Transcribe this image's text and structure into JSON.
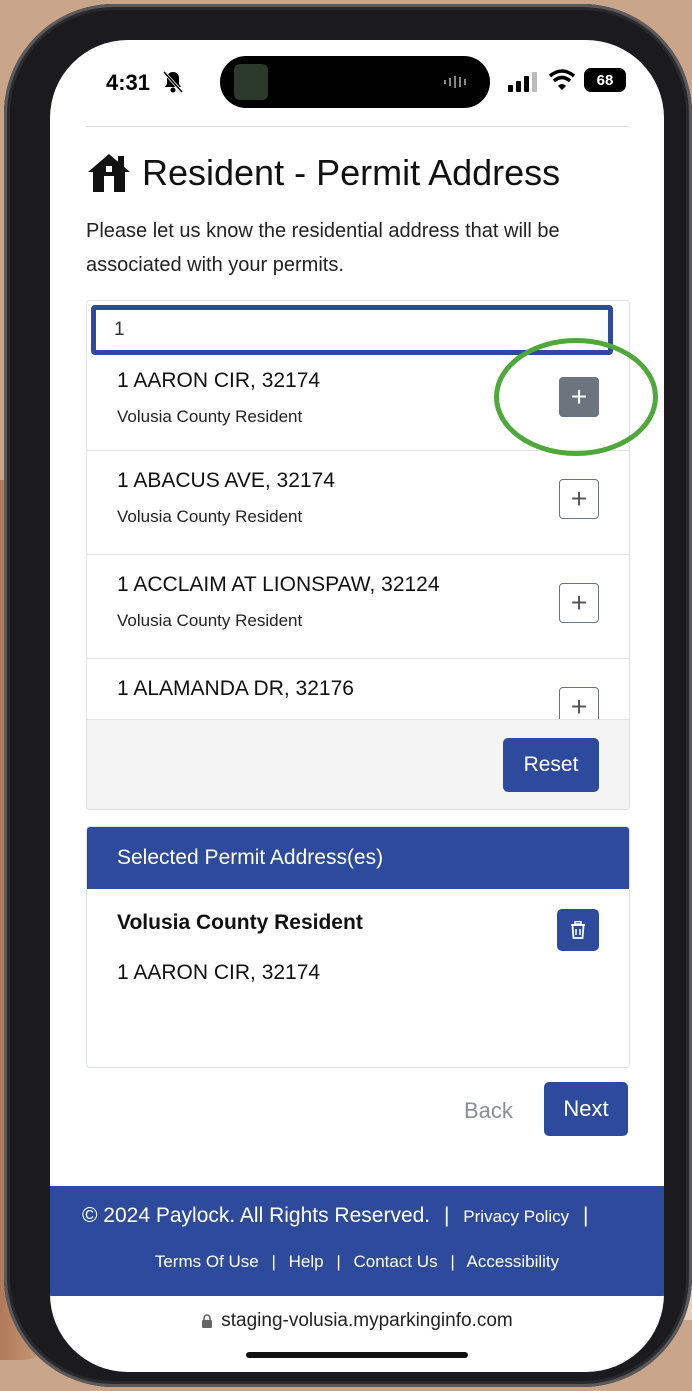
{
  "status_bar": {
    "time": "4:31",
    "battery": "68"
  },
  "page": {
    "title": "Resident - Permit Address",
    "intro": "Please let us know the residential address that will be associated with your permits."
  },
  "search": {
    "value": "1"
  },
  "results": [
    {
      "address": "1 AARON CIR, 32174",
      "type": "Volusia County Resident"
    },
    {
      "address": "1 ABACUS AVE, 32174",
      "type": "Volusia County Resident"
    },
    {
      "address": "1 ACCLAIM AT LIONSPAW, 32124",
      "type": "Volusia County Resident"
    },
    {
      "address": "1 ALAMANDA DR, 32176",
      "type": ""
    }
  ],
  "buttons": {
    "add": "+",
    "reset": "Reset",
    "back": "Back",
    "next": "Next"
  },
  "selected": {
    "header": "Selected Permit Address(es)",
    "type": "Volusia County Resident",
    "address": "1 AARON CIR, 32174"
  },
  "footer": {
    "copyright": "© 2024 Paylock. All Rights Reserved.",
    "separator": "|",
    "privacy": "Privacy Policy",
    "terms": "Terms Of Use",
    "help": "Help",
    "contact": "Contact Us",
    "accessibility": "Accessibility"
  },
  "browser": {
    "url": "staging-volusia.myparkinginfo.com"
  },
  "colors": {
    "primary": "#2e4a9c",
    "highlight_ring": "#4ea83a",
    "secondary_button": "#6c757d"
  },
  "icons": [
    "bell-slash-icon",
    "signal-icon",
    "wifi-icon",
    "home-icon",
    "plus-icon",
    "trash-icon",
    "lock-icon"
  ]
}
